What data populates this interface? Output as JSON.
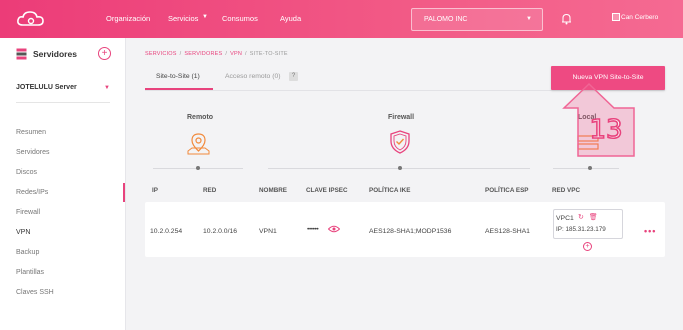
{
  "nav": {
    "items": [
      "Organización",
      "Servicios",
      "Consumos",
      "Ayuda"
    ],
    "organization": "PALOMO INC",
    "user_label": "Can Cerbero"
  },
  "sidebar": {
    "title": "Servidores",
    "server": "JOTELULU Server",
    "items": [
      "Resumen",
      "Servidores",
      "Discos",
      "Redes/IPs",
      "Firewall",
      "VPN",
      "Backup",
      "Plantillas",
      "Claves SSH"
    ],
    "active": "VPN"
  },
  "breadcrumb": [
    "SERVICIOS",
    "SERVIDORES",
    "VPN",
    "SITE-TO-SITE"
  ],
  "tabs": [
    {
      "label": "Site-to-Site (1)",
      "active": true
    },
    {
      "label": "Acceso remoto (0)",
      "active": false
    }
  ],
  "help_badge": "?",
  "new_vpn_button": "Nueva VPN Site-to-Site",
  "diagram": {
    "remote_label": "Remoto",
    "firewall_label": "Firewall",
    "local_label": "Local"
  },
  "annotation": {
    "number": "13"
  },
  "table": {
    "headers": [
      "IP",
      "RED",
      "NOMBRE",
      "CLAVE IPSEC",
      "POLÍTICA IKE",
      "POLÍTICA ESP",
      "RED VPC"
    ],
    "row": {
      "ip": "10.2.0.254",
      "red": "10.2.0.0/16",
      "nombre": "VPN1",
      "clave": "••••••",
      "ike": "AES128-SHA1;MODP1536",
      "esp": "AES128-SHA1",
      "vpc_name": "VPC1",
      "vpc_ip": "IP: 185.31.23.179",
      "more": "•••"
    }
  },
  "colors": {
    "accent": "#e8437d",
    "topbar": "#ec3c78"
  }
}
